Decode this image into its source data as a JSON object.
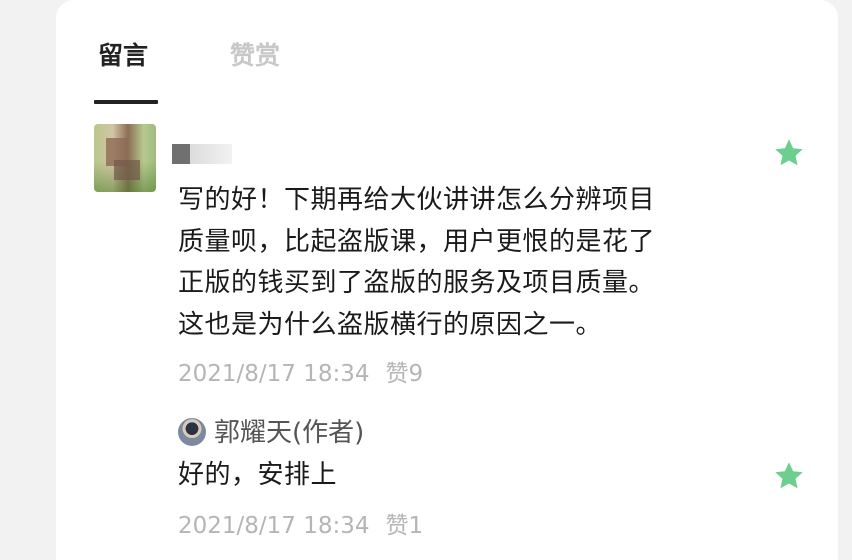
{
  "tabs": [
    {
      "label": "留言",
      "active": true
    },
    {
      "label": "赞赏",
      "active": false
    }
  ],
  "comment": {
    "text_lines": [
      "写的好！下期再给大伙讲讲怎么分辨项目",
      "质量呗，比起盗版课，用户更恨的是花了",
      "正版的钱买到了盗版的服务及项目质量。",
      "这也是为什么盗版横行的原因之一。"
    ],
    "time": "2021/8/17 18:34",
    "likes": "赞9",
    "starred_icon": "star-icon"
  },
  "reply": {
    "author": "郭耀天(作者)",
    "text": "好的，安排上",
    "time": "2021/8/17 18:34",
    "likes": "赞1"
  },
  "colors": {
    "accent_green": "#6ccf8e",
    "text_primary": "#1a1a1a",
    "text_muted": "#b5b5b5"
  }
}
